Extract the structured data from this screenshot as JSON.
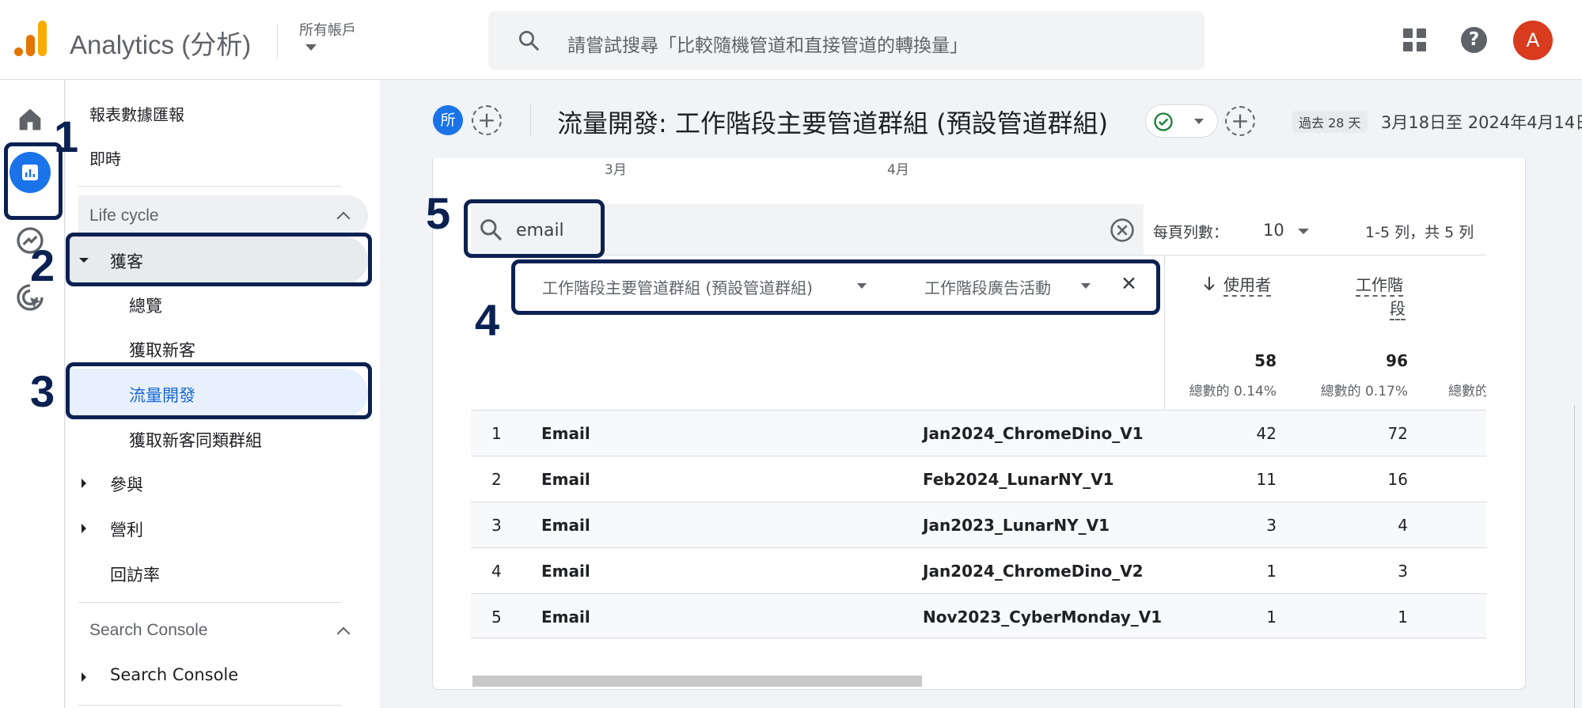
{
  "header": {
    "app_title": "Analytics (分析)",
    "account_label": "所有帳戶",
    "search_placeholder": "請嘗試搜尋「比較隨機管道和直接管道的轉換量」",
    "avatar_letter": "A",
    "help_symbol": "?"
  },
  "nav": {
    "report_snapshot": "報表數據匯報",
    "realtime": "即時",
    "lifecycle_section": "Life cycle",
    "acquisition": "獲客",
    "overview": "總覽",
    "user_acquisition": "獲取新客",
    "traffic_acquisition": "流量開發",
    "cohort": "獲取新客同類群組",
    "engagement": "參與",
    "monetization": "營利",
    "retention": "回訪率",
    "search_console_section": "Search Console",
    "search_console_item": "Search Console"
  },
  "annotations": [
    "1",
    "2",
    "3",
    "4",
    "5"
  ],
  "report": {
    "segment_chip": "所",
    "title": "流量開發: 工作階段主要管道群組 (預設管道群組)",
    "date_badge": "過去 28 天",
    "date_range": "3月18日至 2024年4月14日",
    "chart_tick_1": "3月",
    "chart_tick_2": "4月"
  },
  "table": {
    "search_value": "email",
    "rows_per_page_label": "每頁列數：",
    "rows_per_page_value": "10",
    "pagination": "1-5 列，共 5 列",
    "dim1_header": "工作階段主要管道群組 (預設管道群組)",
    "dim2_header": "工作階段廣告活動",
    "users_header": "使用者",
    "sessions_header_1": "工作階",
    "sessions_header_2": "段",
    "users_total": "58",
    "users_total_pct": "總數的 0.14%",
    "sessions_total": "96",
    "sessions_total_pct": "總數的 0.17%",
    "third_total_pct": "總數的",
    "rows": [
      {
        "idx": "1",
        "channel": "Email",
        "campaign": "Jan2024_ChromeDino_V1",
        "users": "42",
        "sessions": "72"
      },
      {
        "idx": "2",
        "channel": "Email",
        "campaign": "Feb2024_LunarNY_V1",
        "users": "11",
        "sessions": "16"
      },
      {
        "idx": "3",
        "channel": "Email",
        "campaign": "Jan2023_LunarNY_V1",
        "users": "3",
        "sessions": "4"
      },
      {
        "idx": "4",
        "channel": "Email",
        "campaign": "Jan2024_ChromeDino_V2",
        "users": "1",
        "sessions": "3"
      },
      {
        "idx": "5",
        "channel": "Email",
        "campaign": "Nov2023_CyberMonday_V1",
        "users": "1",
        "sessions": "1"
      }
    ]
  },
  "colors": {
    "accent": "#1a73e8",
    "annotation": "#0b2152",
    "avatar": "#d83b1d"
  }
}
